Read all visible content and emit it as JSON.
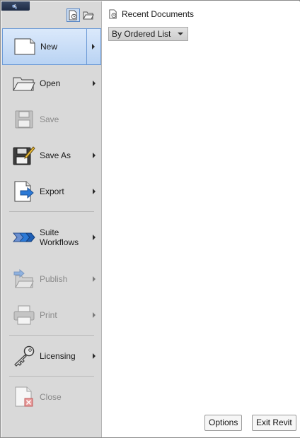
{
  "app_button": {
    "letter": "A"
  },
  "top_icons": [
    {
      "icon": "recent-documents-icon",
      "active": true
    },
    {
      "icon": "open-documents-icon",
      "active": false
    }
  ],
  "menu": {
    "new": "New",
    "open": "Open",
    "save": "Save",
    "save_as": "Save As",
    "export": "Export",
    "suite_workflows": "Suite\nWorkflows",
    "publish": "Publish",
    "print": "Print",
    "licensing": "Licensing",
    "close": "Close"
  },
  "recent": {
    "title": "Recent Documents",
    "sort_dropdown": "By Ordered List"
  },
  "footer": {
    "options": "Options",
    "exit": "Exit Revit"
  },
  "colors": {
    "menu_bg": "#d9d9d9",
    "selected_bg": "#c3d9f5",
    "selected_border": "#6c9ad6",
    "accent_blue": "#2b79d6"
  }
}
